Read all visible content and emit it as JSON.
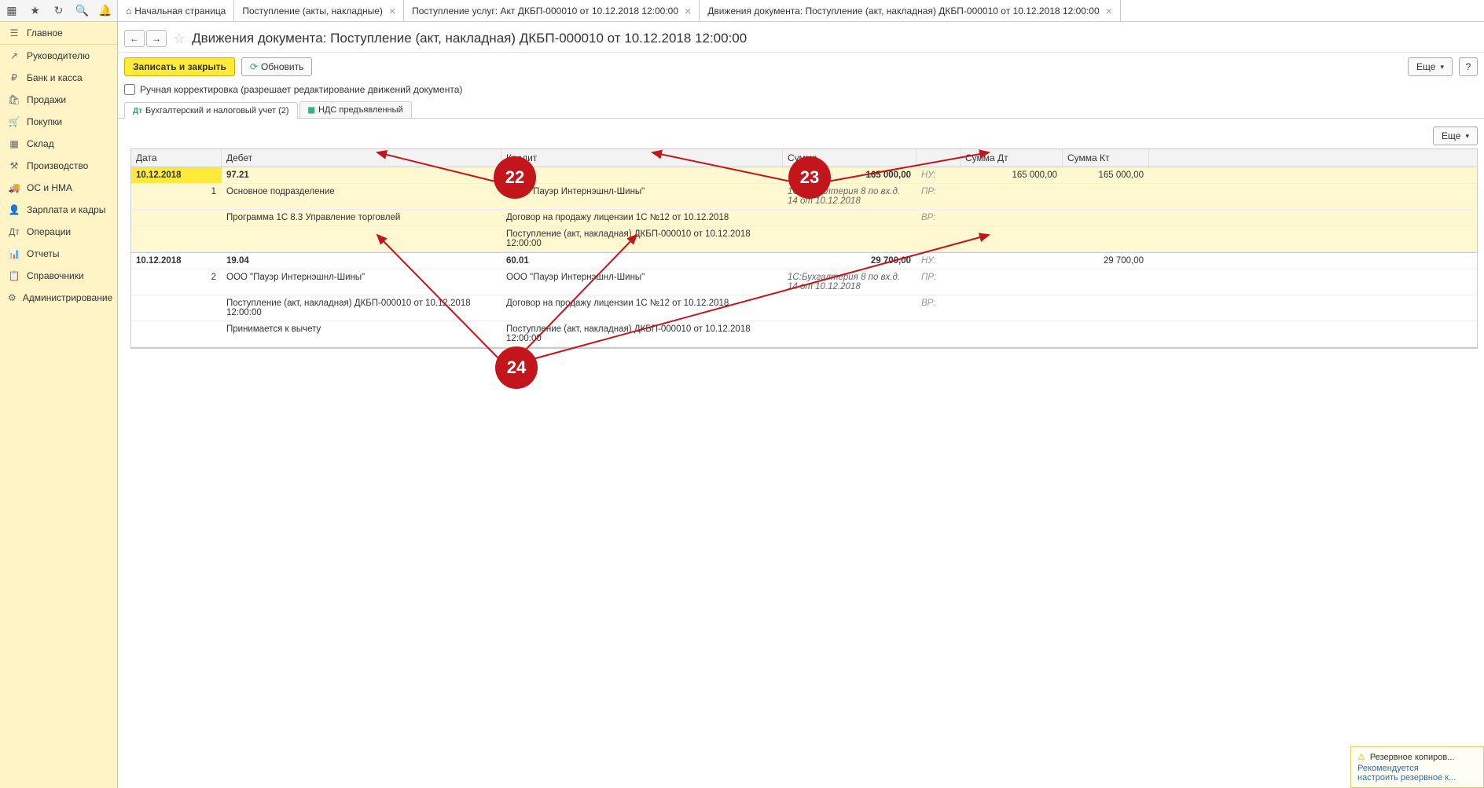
{
  "toolbar_tabs": [
    {
      "label": "Начальная страница",
      "home": true,
      "close": false
    },
    {
      "label": "Поступление (акты, накладные)",
      "close": true
    },
    {
      "label": "Поступление услуг: Акт ДКБП-000010 от 10.12.2018 12:00:00",
      "close": true
    },
    {
      "label": "Движения документа: Поступление (акт, накладная) ДКБП-000010 от 10.12.2018 12:00:00",
      "close": true,
      "active": true
    }
  ],
  "sidebar": [
    {
      "ico": "☰",
      "label": "Главное"
    },
    {
      "ico": "↗",
      "label": "Руководителю"
    },
    {
      "ico": "₽",
      "label": "Банк и касса"
    },
    {
      "ico": "🛍",
      "label": "Продажи"
    },
    {
      "ico": "🛒",
      "label": "Покупки"
    },
    {
      "ico": "▦",
      "label": "Склад"
    },
    {
      "ico": "⚒",
      "label": "Производство"
    },
    {
      "ico": "🚚",
      "label": "ОС и НМА"
    },
    {
      "ico": "👤",
      "label": "Зарплата и кадры"
    },
    {
      "ico": "Дт",
      "label": "Операции"
    },
    {
      "ico": "📊",
      "label": "Отчеты"
    },
    {
      "ico": "📋",
      "label": "Справочники"
    },
    {
      "ico": "⚙",
      "label": "Администрирование"
    }
  ],
  "header": {
    "title": "Движения документа: Поступление (акт, накладная) ДКБП-000010 от 10.12.2018 12:00:00"
  },
  "actions": {
    "save_close": "Записать и закрыть",
    "refresh": "Обновить",
    "more": "Еще",
    "help": "?"
  },
  "checkbox": {
    "label": "Ручная корректировка (разрешает редактирование движений документа)"
  },
  "sub_tabs": [
    {
      "label": "Бухгалтерский и налоговый учет (2)",
      "active": true,
      "ico": "Дт"
    },
    {
      "label": "НДС предъявленный",
      "ico": "▦"
    }
  ],
  "table": {
    "more": "Еще",
    "head": {
      "date": "Дата",
      "debit": "Дебет",
      "credit": "Кредит",
      "sum": "Сумма",
      "sum_dt": "Сумма Дт",
      "sum_kt": "Сумма Кт"
    },
    "tags": {
      "nu": "НУ:",
      "pr": "ПР:",
      "vr": "ВР:"
    },
    "groups": [
      {
        "selected": true,
        "num": "1",
        "rows": [
          {
            "date": "10.12.2018",
            "deb": "97.21",
            "cred": "60.01",
            "sum": "165 000,00",
            "tag": "nu",
            "dt": "165 000,00",
            "kt": "165 000,00",
            "bold": true
          },
          {
            "date": "",
            "deb": "Основное подразделение",
            "cred": "ООО \"Пауэр Интернэшнл-Шины\"",
            "sum_ital": "1С:Бухгалтерия 8 по вх.д. 14 от 10.12.2018",
            "tag": "pr"
          },
          {
            "date": "",
            "deb": "Программа 1С 8.3 Управление торговлей",
            "cred": "Договор на продажу лицензии 1С №12 от 10.12.2018",
            "tag": "vr"
          },
          {
            "date": "",
            "deb": "",
            "cred": "Поступление (акт, накладная) ДКБП-000010 от 10.12.2018 12:00:00"
          }
        ]
      },
      {
        "selected": false,
        "num": "2",
        "rows": [
          {
            "date": "10.12.2018",
            "deb": "19.04",
            "cred": "60.01",
            "sum": "29 700,00",
            "tag": "nu",
            "dt": "",
            "kt": "29 700,00",
            "bold": true
          },
          {
            "date": "",
            "deb": "ООО \"Пауэр Интернэшнл-Шины\"",
            "cred": "ООО \"Пауэр Интернэшнл-Шины\"",
            "sum_ital": "1С:Бухгалтерия 8 по вх.д. 14 от 10.12.2018",
            "tag": "pr"
          },
          {
            "date": "",
            "deb": "Поступление (акт, накладная) ДКБП-000010 от 10.12.2018 12:00:00",
            "cred": "Договор на продажу лицензии 1С №12 от 10.12.2018",
            "tag": "vr"
          },
          {
            "date": "",
            "deb": "Принимается к вычету",
            "cred": "Поступление (акт, накладная) ДКБП-000010 от 10.12.2018 12:00:00"
          }
        ]
      }
    ]
  },
  "annotations": {
    "a22": "22",
    "a23": "23",
    "a24": "24"
  },
  "notif": {
    "title": "Резервное копиров...",
    "line1": "Рекомендуется",
    "line2": "настроить резервное к..."
  }
}
